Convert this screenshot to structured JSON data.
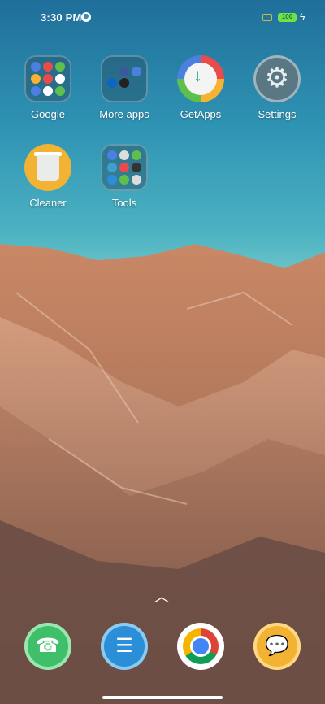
{
  "status_bar": {
    "time": "3:30 PM",
    "battery_level": "100"
  },
  "apps": [
    {
      "label": "Google"
    },
    {
      "label": "More apps"
    },
    {
      "label": "GetApps"
    },
    {
      "label": "Settings"
    },
    {
      "label": "Cleaner"
    },
    {
      "label": "Tools"
    }
  ],
  "dock": [
    "Phone",
    "Notes",
    "Chrome",
    "Messaging"
  ],
  "colors": {
    "sky_top": "#1f6f9a",
    "sky_bottom": "#66c2c7",
    "hills": "#b77a5a"
  }
}
